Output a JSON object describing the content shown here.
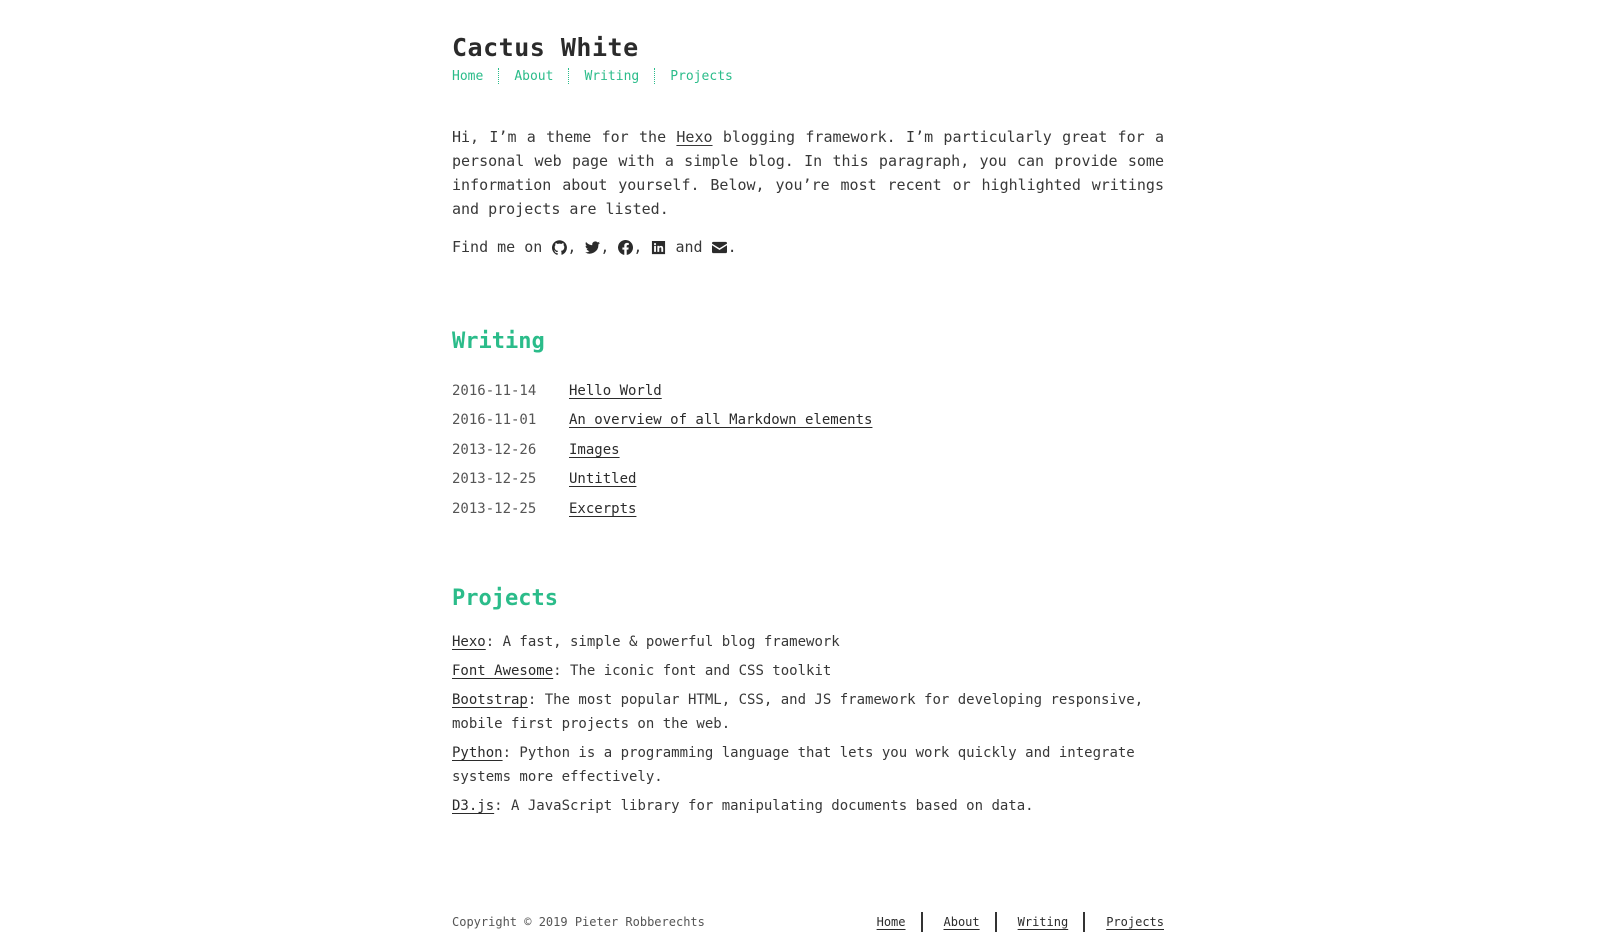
{
  "site": {
    "title": "Cactus White"
  },
  "nav": [
    "Home",
    "About",
    "Writing",
    "Projects"
  ],
  "intro": {
    "p1_before": "Hi, I’m a theme for the ",
    "p1_link": "Hexo",
    "p1_after": " blogging framework. I’m particularly great for a per­sonal web page with a simple blog. In this paragraph, you can provide some informa­tion about yourself. Below, you’re most recent or highlighted writings and projects are listed.",
    "find_prefix": "Find me on ",
    "comma": ",",
    "and": " and ",
    "period": ".",
    "social_icons": [
      "github-icon",
      "twitter-icon",
      "facebook-icon",
      "linkedin-icon",
      "envelope-icon"
    ]
  },
  "writing": {
    "heading": "Writing",
    "posts": [
      {
        "date": "2016-11-14",
        "title": "Hello World"
      },
      {
        "date": "2016-11-01",
        "title": "An overview of all Markdown elements"
      },
      {
        "date": "2013-12-26",
        "title": "Images"
      },
      {
        "date": "2013-12-25",
        "title": "Untitled"
      },
      {
        "date": "2013-12-25",
        "title": "Excerpts"
      }
    ]
  },
  "projects": {
    "heading": "Projects",
    "items": [
      {
        "name": "Hexo",
        "desc": ": A fast, simple & powerful blog framework"
      },
      {
        "name": "Font Awesome",
        "desc": ": The iconic font and CSS toolkit"
      },
      {
        "name": "Bootstrap",
        "desc": ": The most popular HTML, CSS, and JS framework for developing responsive, mobile first projects on the web."
      },
      {
        "name": "Python",
        "desc": ": Python is a programming language that lets you work quickly and integrate systems more effectively."
      },
      {
        "name": "D3.js",
        "desc": ": A JavaScript library for manipulating documents based on data."
      }
    ]
  },
  "footer": {
    "copyright": "Copyright © 2019 Pieter Robberechts",
    "nav": [
      "Home",
      "About",
      "Writing",
      "Projects"
    ]
  },
  "colors": {
    "accent": "#2bbc8a",
    "text": "#383838"
  }
}
